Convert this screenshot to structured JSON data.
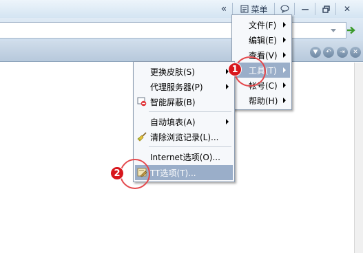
{
  "titlebar": {
    "collapse_glyph": "«",
    "menu_label": "菜单",
    "menu_icon": "menu-list-icon",
    "chat_icon": "speech-bubble-icon",
    "minimize_glyph": "—",
    "restore_icon": "restore-icon",
    "close_glyph": "✕"
  },
  "address": {
    "value": "",
    "dropdown_icon": "dropdown-arrow-icon",
    "go_icon": "go-arrow-icon",
    "go_color": "#3a9a2a"
  },
  "tabbar": {
    "buttons": [
      "chevron-down-icon",
      "undo-icon",
      "pin-icon",
      "close-icon"
    ]
  },
  "main_menu": {
    "items": [
      {
        "label": "文件(F)",
        "underline": "F",
        "submenu": true
      },
      {
        "label": "编辑(E)",
        "underline": "E",
        "submenu": true
      },
      {
        "label": "查看(V)",
        "underline": "V",
        "submenu": true
      },
      {
        "label": "工具(T)",
        "underline": "T",
        "submenu": true,
        "active": true
      },
      {
        "label": "帐号(C)",
        "underline": "C",
        "submenu": true
      },
      {
        "label": "帮助(H)",
        "underline": "H",
        "submenu": true
      }
    ]
  },
  "tools_menu": {
    "items": [
      {
        "label": "更换皮肤(S)",
        "submenu": true
      },
      {
        "label": "代理服务器(P)",
        "submenu": true
      },
      {
        "label": "智能屏蔽(B)",
        "icon": "block-icon"
      },
      {
        "label": "自动填表(A)",
        "submenu": true
      },
      {
        "label": "清除浏览记录(L)...",
        "icon": "broom-icon"
      },
      {
        "label": "Internet选项(O)..."
      },
      {
        "label": "TT选项(T)...",
        "icon": "settings-wrench-icon",
        "active": true
      }
    ]
  },
  "callouts": [
    {
      "number": "1"
    },
    {
      "number": "2"
    }
  ],
  "colors": {
    "callout_red": "#d8161c",
    "menu_highlight": "#9aaec9"
  }
}
